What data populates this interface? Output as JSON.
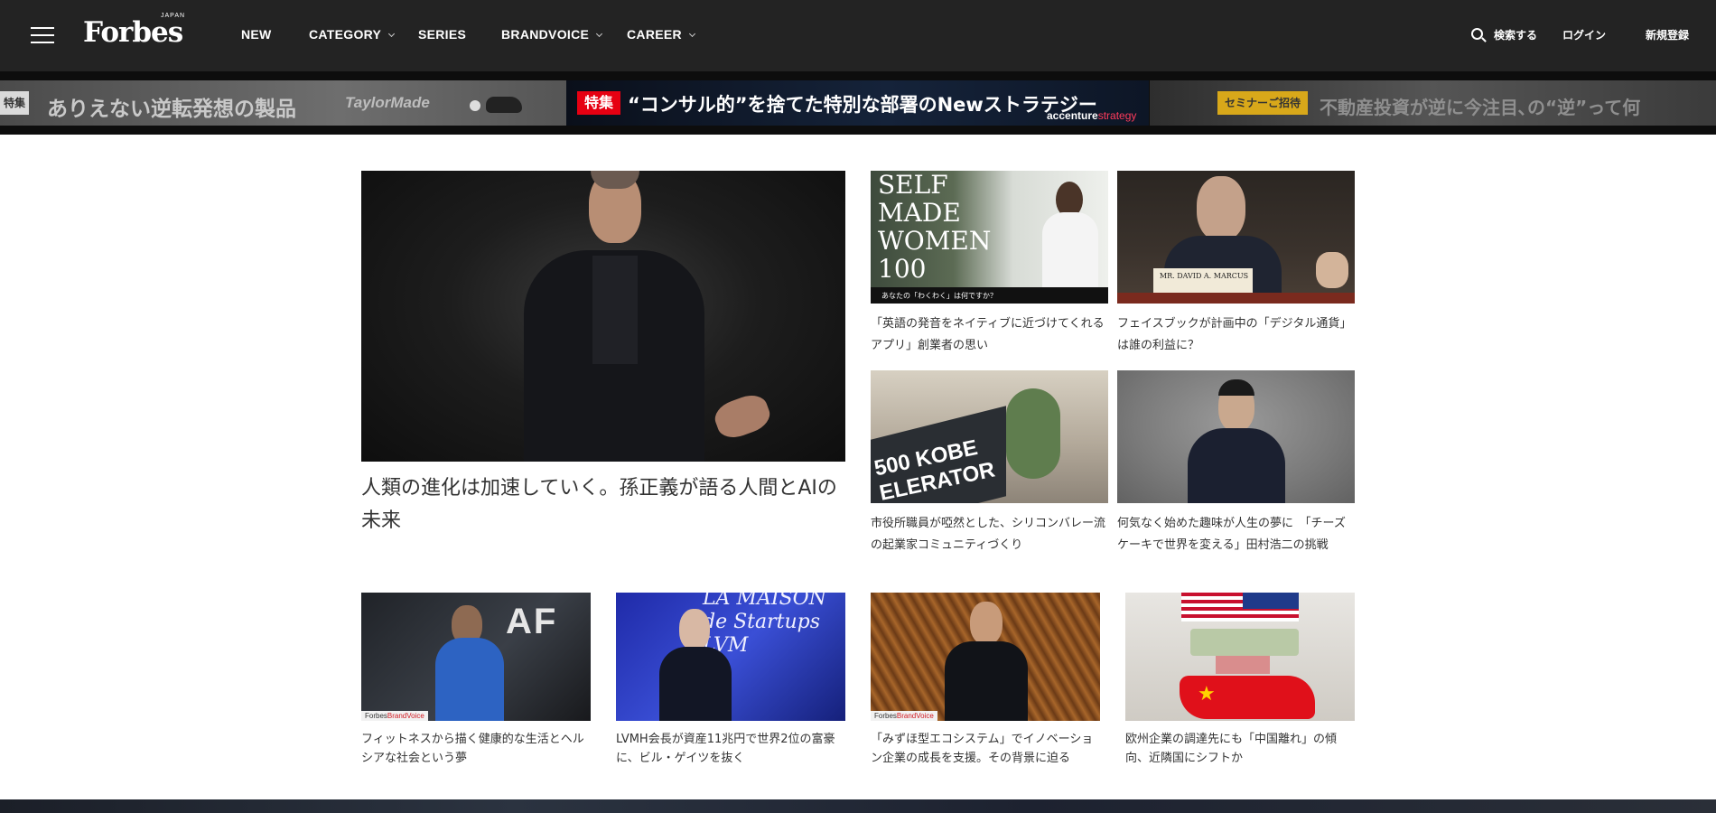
{
  "header": {
    "logo": "Forbes",
    "logo_sub": "JAPAN",
    "nav": [
      {
        "label": "NEW",
        "dropdown": false
      },
      {
        "label": "CATEGORY",
        "dropdown": true
      },
      {
        "label": "SERIES",
        "dropdown": false
      },
      {
        "label": "BRANDVOICE",
        "dropdown": true
      },
      {
        "label": "CAREER",
        "dropdown": true
      }
    ],
    "search_label": "検索する",
    "login_label": "ログイン",
    "signup_label": "新規登録"
  },
  "banners": [
    {
      "tag": "特集",
      "text": "ありえない逆転発想の製品",
      "brand": "TaylorMade"
    },
    {
      "tag": "特集",
      "text": "“コンサル的”を捨てた特別な部署のNewストラテジー",
      "brand": "accenture",
      "brand_sub": "strategy"
    },
    {
      "tag": "セミナーご招待",
      "text": "不動産投資が逆に今注目､の“逆”って何"
    }
  ],
  "hero": {
    "title": "人類の進化は加速していく。孫正義が語る人間とAIの未来"
  },
  "cards": [
    {
      "title": "「英語の発音をネイティブに近づけてくれるアプリ」創業者の思い",
      "overlay": "SELF\nMADE\nWOMEN\n100",
      "overlay_caption": "あなたの「わくわく」は何ですか？"
    },
    {
      "title": "フェイスブックが計画中の「デジタル通貨」は誰の利益に？",
      "overlay_caption": "MR. DAVID A. MARCUS"
    },
    {
      "title": "市役所職員が啞然とした、シリコンバレー流の起業家コミュニティづくり",
      "overlay": "500 KOBE\nELERATOR"
    },
    {
      "title": "何気なく始めた趣味が人生の夢に　「チーズケーキで世界を変える」田村浩二の挑戦"
    }
  ],
  "wide_cards": [
    {
      "title": "フィットネスから描く健康的な生活とヘルシアな社会という夢",
      "brandvoice": true
    },
    {
      "title": "LVMH会長が資産11兆円で世界2位の富豪に、ビル・ゲイツを抜く",
      "overlay": "LA MAISON\nde Startups\nLVM"
    },
    {
      "title": "「みずほ型エコシステム」でイノベーション企業の成長を支援。その背景に迫る",
      "brandvoice": true
    },
    {
      "title": "欧州企業の調達先にも「中国離れ」の傾向、近隣国にシフトか"
    }
  ],
  "brandvoice_label": {
    "pre": "Forbes",
    "post": "BrandVoice"
  },
  "colors": {
    "header_bg": "#232323",
    "feature_red": "#e60012",
    "seminar_gold": "#d8a81a"
  }
}
